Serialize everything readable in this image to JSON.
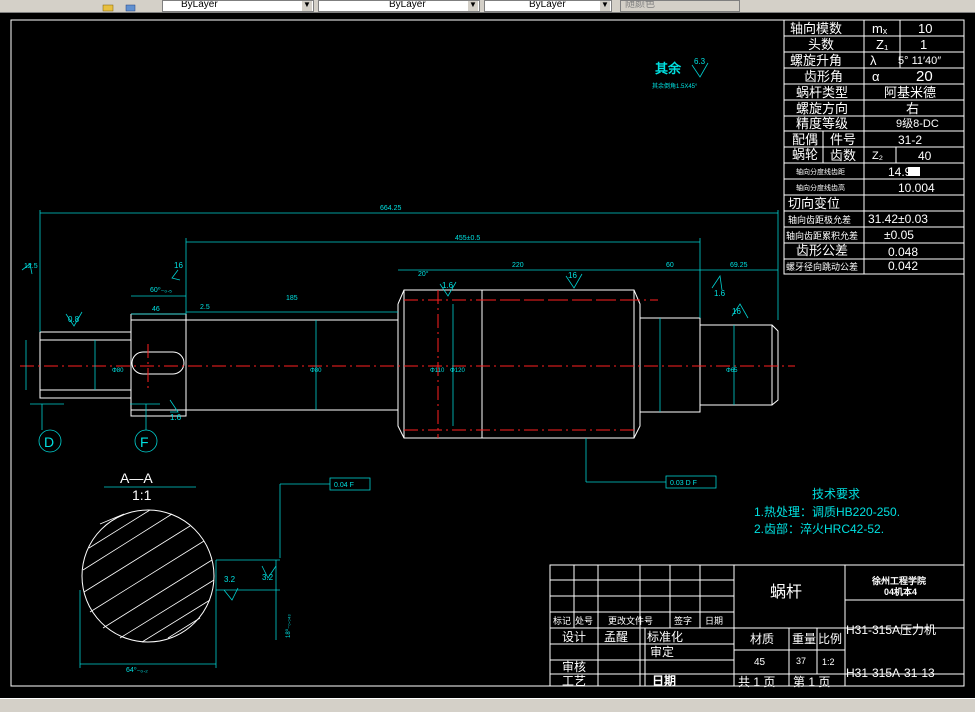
{
  "toolbar": {
    "layer1": "ByLayer",
    "layer2": "ByLayer",
    "layer3": "ByLayer",
    "plotstyle": "随颜色"
  },
  "param_table": {
    "rows": [
      {
        "label": "轴向模数",
        "sym": "mₓ",
        "val": "10"
      },
      {
        "label": "头数",
        "sym": "Z₁",
        "val": "1"
      },
      {
        "label": "螺旋升角",
        "sym": "λ",
        "val": "5° 11′40″"
      },
      {
        "label": "齿形角",
        "sym": "α",
        "val": "20"
      },
      {
        "label": "蜗杆类型",
        "sym": "",
        "val": "阿基米德"
      },
      {
        "label": "螺旋方向",
        "sym": "",
        "val": "右"
      },
      {
        "label": "精度等级",
        "sym": "",
        "val": "9级8-DC"
      }
    ],
    "mate_label_1": "配偶",
    "mate_label_2": "蜗轮",
    "part_no_label": "件号",
    "part_no_val": "31-2",
    "teeth_label": "齿数",
    "teeth_sym": "Z₂",
    "teeth_val": "40",
    "r_a_label": "轴向分度线齿距",
    "r_a_val": "14.92",
    "r_b_label": "轴向分度线齿高",
    "r_b_val": "10.004",
    "r_c_label": "切向变位",
    "r_d_label": "轴向齿距极允差",
    "r_d_val": "31.42±0.03",
    "r_e_label": "轴向齿距累积允差",
    "r_e_val": "±0.05",
    "r_f_label": "齿形公差",
    "r_f_val": "0.048",
    "r_g_label": "螺牙径向跳动公差",
    "r_g_val": "0.042"
  },
  "roughness_note": {
    "label": "其余",
    "value": "6.3",
    "sub": "其余倒角1.5X45°"
  },
  "dims": {
    "overall": "664.25",
    "d455": "455±0.5",
    "d220": "220",
    "d60": "60",
    "d6925": "69.25",
    "d60b": "60⁰₋₀.₅",
    "d46": "46",
    "d25": "2.5",
    "d185": "185",
    "a20": "20°",
    "r16a": "1.6",
    "r16b": "16",
    "r16c": "1.6",
    "r16d": "16",
    "r16e": "1.6",
    "r16f": "16",
    "r125": "12.5",
    "r08": "0.8",
    "dia80": "Φ80",
    "dia110": "Φ110",
    "dia120": "Φ120",
    "dia80b": "Φ80",
    "dia65": "Φ65"
  },
  "callouts": {
    "d_label": "D",
    "f_label": "F",
    "tol1": "0.03 D F",
    "tol2": "0.04 F"
  },
  "section": {
    "title": "A—A",
    "scale": "1:1",
    "r32a": "3.2",
    "r32b": "3.2",
    "dim_bottom": "64⁰₋₀.₂",
    "dim_side": "18⁰₋₀.₀₄₃"
  },
  "tech": {
    "title": "技术要求",
    "line1": "1.热处理：调质HB220-250.",
    "line2": "2.齿部：淬火HRC42-52."
  },
  "title_block": {
    "part_name": "蜗杆",
    "school1": "徐州工程学院",
    "school2": "04机本4",
    "drawing_name": "H31-315A压力机",
    "drawing_no": "H31-315A-31-13",
    "rev_mark": "标记",
    "rev_zone": "处号",
    "rev_doc": "更改文件号",
    "rev_sign": "签字",
    "rev_date": "日期",
    "design": "设计",
    "designer": "孟醒",
    "standard": "标准化",
    "check": "审核",
    "approve": "审定",
    "process": "工艺",
    "date": "日期",
    "material_label": "材质",
    "weight_label": "重量",
    "scale_label": "比例",
    "material": "45",
    "weight": "37",
    "scale": "1:2",
    "total": "共  1 页",
    "page": "第  1 页"
  }
}
